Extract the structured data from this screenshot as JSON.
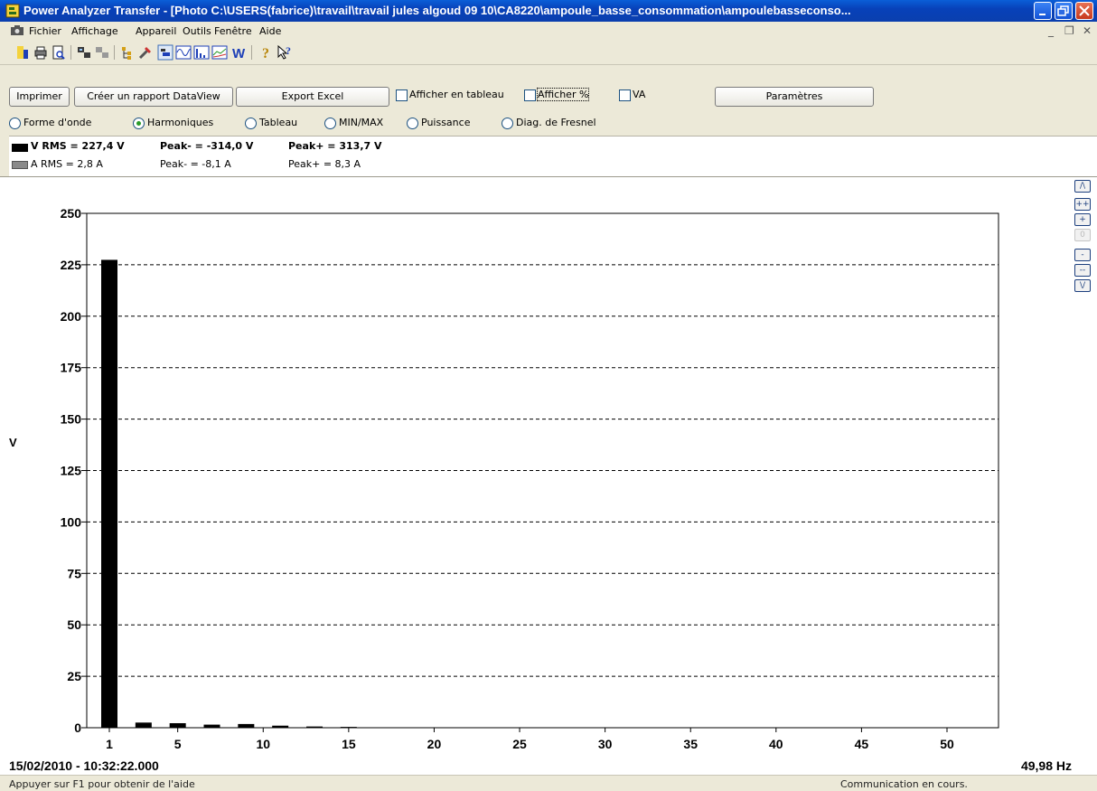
{
  "window": {
    "title": "Power Analyzer Transfer - [Photo C:\\USERS(fabrice)\\travail\\travail jules algoud 09 10\\CA8220\\ampoule_basse_consommation\\ampoulebasseconso..."
  },
  "menu": [
    "Fichier",
    "Affichage",
    "Appareil",
    "Outils",
    "Fenêtre",
    "Aide"
  ],
  "toolbar_icons": [
    "new-icon",
    "print-icon",
    "print-preview-icon",
    "connect-icon",
    "disconnect-icon",
    "tree-icon",
    "tools-icon",
    "photo-icon",
    "waveform-icon",
    "spectrum-icon",
    "trend-icon",
    "power-icon",
    "help-icon",
    "context-help-icon"
  ],
  "controls": {
    "imprimer": "Imprimer",
    "rapport": "Créer un rapport DataView",
    "export": "Export Excel",
    "afficher_tableau": "Afficher en tableau",
    "afficher_pct": "Afficher %",
    "va": "VA",
    "parametres": "Paramètres"
  },
  "views": {
    "options": [
      "Forme d'onde",
      "Harmoniques",
      "Tableau",
      "MIN/MAX",
      "Puissance",
      "Diag. de Fresnel"
    ],
    "selected": "Harmoniques"
  },
  "measurements": {
    "v_rms": "V RMS = 227,4 V",
    "v_peak_minus": "Peak- = -314,0 V",
    "v_peak_plus": "Peak+ = 313,7 V",
    "a_rms": "A RMS = 2,8 A",
    "a_peak_minus": "Peak- = -8,1 A",
    "a_peak_plus": "Peak+ = 8,3 A"
  },
  "chart_data": {
    "type": "bar",
    "ylabel": "V",
    "ylim": [
      0,
      250
    ],
    "xlim": [
      0,
      53
    ],
    "yticks": [
      0,
      25,
      50,
      75,
      100,
      125,
      150,
      175,
      200,
      225,
      250
    ],
    "xticks": [
      1,
      5,
      10,
      15,
      20,
      25,
      30,
      35,
      40,
      45,
      50
    ],
    "x": [
      1,
      3,
      5,
      7,
      9,
      11,
      13,
      15
    ],
    "values": [
      227.4,
      2.5,
      2.2,
      1.5,
      1.8,
      1.0,
      0.6,
      0.4
    ],
    "grid": true,
    "timestamp": "15/02/2010 - 10:32:22.000",
    "frequency": "49,98 Hz"
  },
  "zoom_buttons": [
    "/\\",
    "++",
    "+",
    "0",
    "-",
    "--",
    "\\/"
  ],
  "status": {
    "help": "Appuyer sur F1 pour obtenir de l'aide",
    "comm": "Communication en cours."
  }
}
